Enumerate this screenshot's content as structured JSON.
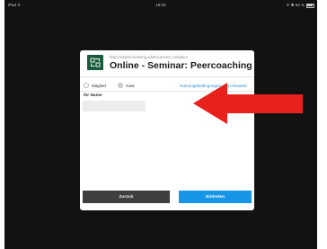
{
  "status_bar": {
    "left": "iPad  ✈ ",
    "time": "19:20",
    "right": "✈ ✱ 64 %"
  },
  "dialog": {
    "logo_icon": "adobe-connect-logo-icon",
    "url": "http://mission-learning.adobeconnect.com/peer",
    "title": "Online - Seminar: Peercoaching",
    "role_options": [
      {
        "label": "Mitglied",
        "selected": false
      },
      {
        "label": "Gast",
        "selected": true
      }
    ],
    "terms_link": "Nutzungsbedingungen und Hinweise",
    "name_label": "Ihr Name",
    "name_value": "",
    "back_button": "Zurück",
    "enter_button": "Eintreten"
  },
  "annotation": {
    "arrow_icon": "red-arrow-left-icon",
    "color": "#e8211c"
  }
}
